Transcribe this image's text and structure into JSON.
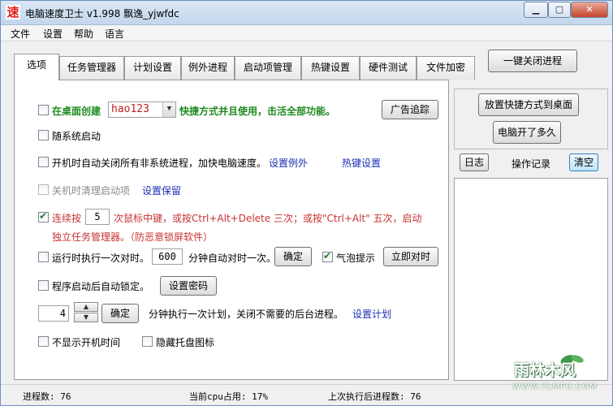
{
  "window": {
    "title": "电脑速度卫士 v1.998 飘逸_yjwfdc",
    "app_icon_char": "速",
    "minimize": "▁",
    "maximize": "▢",
    "close": "✕"
  },
  "menu": [
    "文件",
    "设置",
    "帮助",
    "语言"
  ],
  "tabs": [
    "选项",
    "任务管理器",
    "计划设置",
    "例外进程",
    "启动项管理",
    "热键设置",
    "硬件测试",
    "文件加密"
  ],
  "active_tab": "选项",
  "top_right_button": "一键关闭进程",
  "options": {
    "desktop_create_label": "在桌面创建",
    "desktop_combo_value": "hao123",
    "desktop_create_suffix": "快捷方式并且使用，击活全部功能。",
    "ad_button": "广告追踪",
    "autostart_label": "随系统启动",
    "auto_close_label": "开机时自动关闭所有非系统进程，加快电脑速度。",
    "auto_close_link1": "设置例外",
    "auto_close_link2": "热键设置",
    "clean_startup_label": "关机时清理启动项",
    "clean_startup_link": "设置保留",
    "continuous_label": "连续按",
    "continuous_value": "5",
    "continuous_text1": "次鼠标中键，或按Ctrl+Alt+Delete 三次；或按\"Ctrl+Alt\" 五次，启动",
    "continuous_text2": "独立任务管理器。（防恶意锁屏软件）",
    "run_time_label": "运行时执行一次对时。",
    "run_time_value": "600",
    "run_time_suffix": "分钟自动对时一次。",
    "run_time_confirm": "确定",
    "bubble_label": "气泡提示",
    "sync_now_button": "立即对时",
    "lock_label": "程序启动后自动锁定。",
    "set_password_button": "设置密码",
    "plan_value": "4",
    "plan_confirm": "确定",
    "plan_text": "分钟执行一次计划，关闭不需要的后台进程。",
    "plan_link": "设置计划",
    "hide_boot_time_label": "不显示开机时间",
    "hide_tray_label": "隐藏托盘图标"
  },
  "side": {
    "place_shortcut_button": "放置快捷方式到桌面",
    "uptime_button": "电脑开了多久",
    "log_button": "日志",
    "log_title": "操作记录",
    "clear_button": "清空"
  },
  "status": {
    "process_count": "进程数: 76",
    "cpu_usage": "当前cpu占用: 17%",
    "last_run": "上次执行后进程数: 76"
  },
  "watermark": {
    "title": "雨林木风",
    "subtitle": "WWW.YLMFU.COM"
  }
}
